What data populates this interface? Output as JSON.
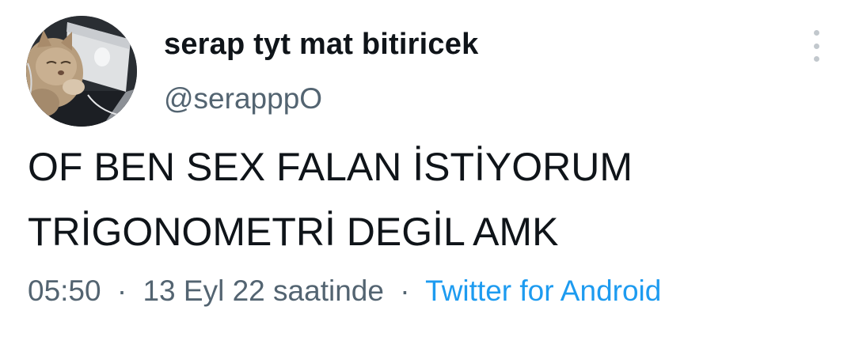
{
  "tweet": {
    "author": {
      "display_name": "serap tyt mat bitiricek",
      "handle": "@serapppO",
      "avatar_icon": "cat-with-laptop-avatar"
    },
    "more_icon": "vertical-ellipsis-icon",
    "text_lines": [
      "OF BEN SEX FALAN İSTİYORUM",
      "TRİGONOMETRİ DEGİL AMK"
    ],
    "meta": {
      "time": "05:50",
      "separator": "·",
      "date": "13 Eyl 22 saatinde",
      "source": "Twitter for Android"
    }
  },
  "colors": {
    "text": "#0f1419",
    "secondary": "#536471",
    "link": "#1d9bf0",
    "background": "#ffffff"
  }
}
